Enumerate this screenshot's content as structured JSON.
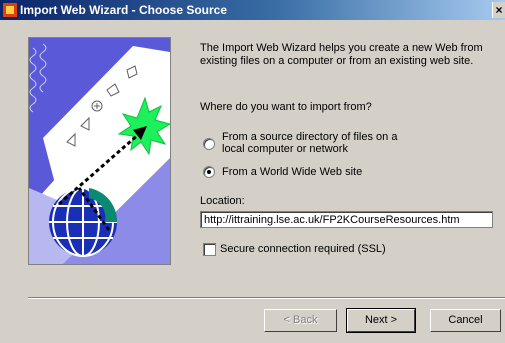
{
  "window": {
    "title": "Import Web Wizard - Choose Source",
    "close_glyph": "×"
  },
  "intro": {
    "line1": "The Import Web Wizard helps you create a new Web from",
    "line2": "existing files on a computer or from an existing web site."
  },
  "question": "Where do you want to import from?",
  "options": [
    {
      "line1": "From a source directory of files on a",
      "line2": "local computer or network",
      "selected": false
    },
    {
      "line1": "From a World Wide Web site",
      "selected": true
    }
  ],
  "location": {
    "label": "Location:",
    "value": "http://ittraining.lse.ac.uk/FP2KCourseResources.htm"
  },
  "ssl": {
    "label": "Secure connection required (SSL)",
    "checked": false
  },
  "buttons": {
    "back": "< Back",
    "next": "Next >",
    "cancel": "Cancel"
  }
}
